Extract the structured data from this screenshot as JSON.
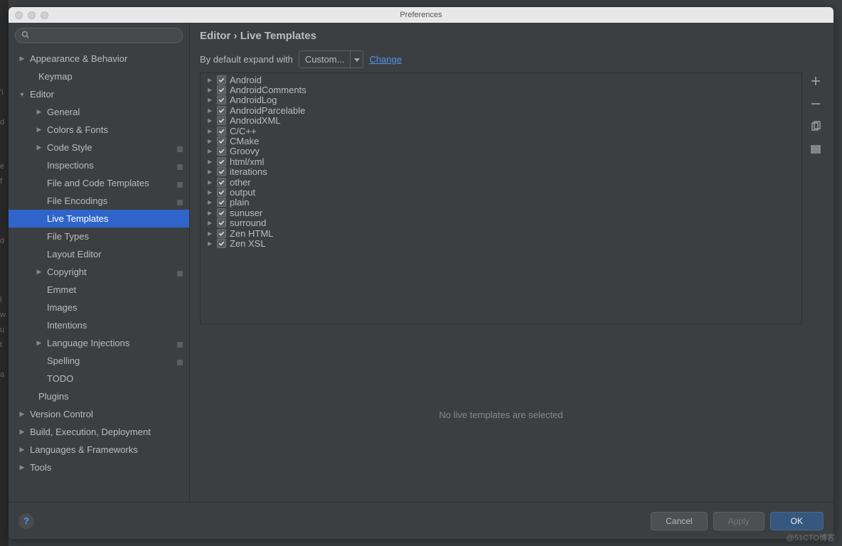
{
  "window": {
    "title": "Preferences"
  },
  "search": {
    "placeholder": ""
  },
  "sidebar": {
    "items": [
      {
        "label": "Appearance & Behavior",
        "indent": 14,
        "arrow": "right"
      },
      {
        "label": "Keymap",
        "indent": 26
      },
      {
        "label": "Editor",
        "indent": 14,
        "arrow": "down"
      },
      {
        "label": "General",
        "indent": 38,
        "arrow": "right"
      },
      {
        "label": "Colors & Fonts",
        "indent": 38,
        "arrow": "right"
      },
      {
        "label": "Code Style",
        "indent": 38,
        "arrow": "right",
        "badge": true
      },
      {
        "label": "Inspections",
        "indent": 38,
        "badge": true
      },
      {
        "label": "File and Code Templates",
        "indent": 38,
        "badge": true
      },
      {
        "label": "File Encodings",
        "indent": 38,
        "badge": true
      },
      {
        "label": "Live Templates",
        "indent": 38,
        "selected": true
      },
      {
        "label": "File Types",
        "indent": 38
      },
      {
        "label": "Layout Editor",
        "indent": 38
      },
      {
        "label": "Copyright",
        "indent": 38,
        "arrow": "right",
        "badge": true
      },
      {
        "label": "Emmet",
        "indent": 38
      },
      {
        "label": "Images",
        "indent": 38
      },
      {
        "label": "Intentions",
        "indent": 38
      },
      {
        "label": "Language Injections",
        "indent": 38,
        "arrow": "right",
        "badge": true
      },
      {
        "label": "Spelling",
        "indent": 38,
        "badge": true
      },
      {
        "label": "TODO",
        "indent": 38
      },
      {
        "label": "Plugins",
        "indent": 26
      },
      {
        "label": "Version Control",
        "indent": 14,
        "arrow": "right"
      },
      {
        "label": "Build, Execution, Deployment",
        "indent": 14,
        "arrow": "right"
      },
      {
        "label": "Languages & Frameworks",
        "indent": 14,
        "arrow": "right"
      },
      {
        "label": "Tools",
        "indent": 14,
        "arrow": "right"
      }
    ]
  },
  "breadcrumb": {
    "section": "Editor",
    "page": "Live Templates"
  },
  "expand": {
    "label": "By default expand with",
    "value": "Custom...",
    "change": "Change"
  },
  "templates": [
    "Android",
    "AndroidComments",
    "AndroidLog",
    "AndroidParcelable",
    "AndroidXML",
    "C/C++",
    "CMake",
    "Groovy",
    "html/xml",
    "iterations",
    "other",
    "output",
    "plain",
    "sunuser",
    "surround",
    "Zen HTML",
    "Zen XSL"
  ],
  "detail": {
    "empty": "No live templates are selected"
  },
  "buttons": {
    "cancel": "Cancel",
    "apply": "Apply",
    "ok": "OK"
  },
  "watermark": "@51CTO博客"
}
